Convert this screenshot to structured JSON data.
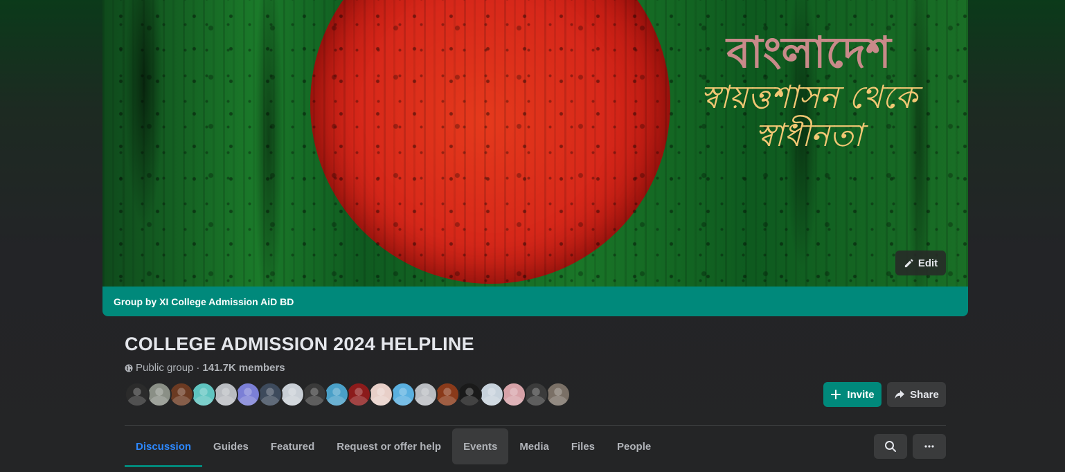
{
  "cover": {
    "art_line1": "বাংলাদেশ",
    "art_line2": "স্বায়ত্তশাসন থেকে",
    "art_line3": "স্বাধীনতা",
    "edit_label": "Edit",
    "banner_text": "Group by XI College Admission AiD BD"
  },
  "group": {
    "title": "COLLEGE ADMISSION 2024 HELPLINE",
    "privacy": "Public group",
    "separator": "·",
    "members": "141.7K members"
  },
  "member_avatars": [
    {
      "color": "#2b2b2b"
    },
    {
      "color": "#8a8f86"
    },
    {
      "color": "#6b3a22"
    },
    {
      "color": "#5fc4c0"
    },
    {
      "color": "#b9bcc1"
    },
    {
      "color": "#7b7fd6"
    },
    {
      "color": "#3d4a5c"
    },
    {
      "color": "#c9cfd6"
    },
    {
      "color": "#3a3a3a"
    },
    {
      "color": "#4aa0c8"
    },
    {
      "color": "#8c1b1b"
    },
    {
      "color": "#e8cfc8"
    },
    {
      "color": "#5ab0e0"
    },
    {
      "color": "#b9bcc1"
    },
    {
      "color": "#8a3a1a"
    },
    {
      "color": "#1a1a1a"
    },
    {
      "color": "#c7d2dc"
    },
    {
      "color": "#d7a2a8"
    },
    {
      "color": "#3b3b3b"
    },
    {
      "color": "#7a7066"
    }
  ],
  "actions": {
    "invite_label": "Invite",
    "share_label": "Share"
  },
  "tabs": [
    {
      "label": "Discussion",
      "state": "active"
    },
    {
      "label": "Guides",
      "state": "normal"
    },
    {
      "label": "Featured",
      "state": "normal"
    },
    {
      "label": "Request or offer help",
      "state": "normal"
    },
    {
      "label": "Events",
      "state": "hover"
    },
    {
      "label": "Media",
      "state": "normal"
    },
    {
      "label": "Files",
      "state": "normal"
    },
    {
      "label": "People",
      "state": "normal"
    }
  ],
  "tab_icons": {
    "search": "search-icon",
    "more": "more-icon"
  },
  "colors": {
    "accent": "#00897b",
    "active_tab_text": "#2d88ff",
    "background": "#242526"
  }
}
